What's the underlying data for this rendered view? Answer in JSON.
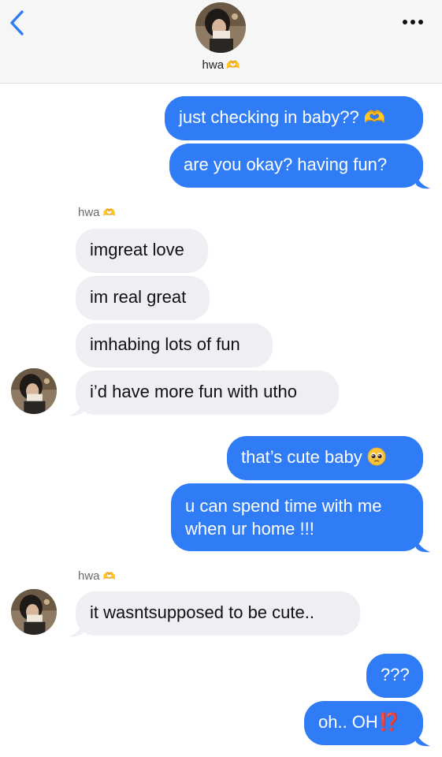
{
  "header": {
    "contact_name": "hwa",
    "contact_emoji": "🫶",
    "back_icon": "chevron-left-icon",
    "more_icon": "ellipsis-icon"
  },
  "colors": {
    "outgoing_bubble": "#2f7cf6",
    "incoming_bubble": "#efeff3",
    "accent": "#2f7cf6"
  },
  "messages": [
    {
      "from": "me",
      "text": "just checking in baby??",
      "emoji": "🫶"
    },
    {
      "from": "me",
      "text": "are you okay? having fun?"
    },
    {
      "from": "hwa",
      "sender_label": "hwa",
      "sender_emoji": "🫶",
      "text": "imgreat love"
    },
    {
      "from": "hwa",
      "text": "im real great"
    },
    {
      "from": "hwa",
      "text": "imhabing lots of fun"
    },
    {
      "from": "hwa",
      "text": "i’d have more fun with utho"
    },
    {
      "from": "me",
      "text": "that’s cute baby",
      "emoji": "🥺"
    },
    {
      "from": "me",
      "line1": "u can spend time with me",
      "line2": "when ur home !!!"
    },
    {
      "from": "hwa",
      "sender_label": "hwa",
      "sender_emoji": "🫶",
      "text": "it wasntsupposed to be cute.."
    },
    {
      "from": "me",
      "text": "???"
    },
    {
      "from": "me",
      "text": "oh.. OH",
      "emoji": "⁉️"
    }
  ]
}
